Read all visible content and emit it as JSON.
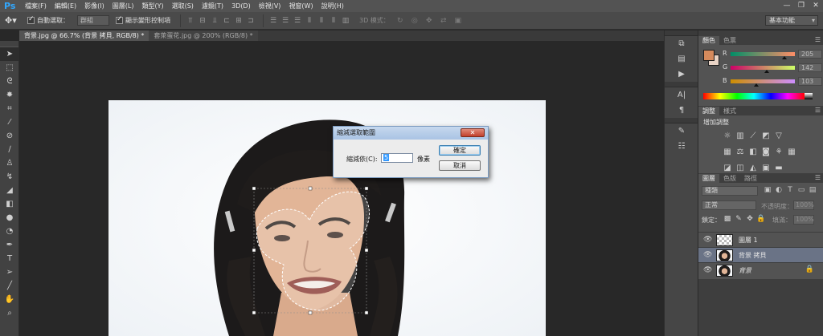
{
  "app": {
    "logo": "Ps"
  },
  "menu": [
    "檔案(F)",
    "編輯(E)",
    "影像(I)",
    "圖層(L)",
    "類型(Y)",
    "選取(S)",
    "濾鏡(T)",
    "3D(D)",
    "檢視(V)",
    "視窗(W)",
    "說明(H)"
  ],
  "window_controls": {
    "minimize": "—",
    "restore": "❐",
    "close": "✕"
  },
  "options": {
    "auto_select_label": "自動選取：",
    "auto_select_checked": true,
    "auto_select_target": "群組",
    "show_transform_label": "顯示變形控制項",
    "show_transform_checked": true,
    "mode_3d_label": "3D 模式：",
    "workspace": "基本功能"
  },
  "tabs": [
    {
      "label": "背景.jpg @ 66.7% (背景 拷貝, RGB/8) *",
      "active": true
    },
    {
      "label": "套萊蛋花.jpg @ 200% (RGB/8) *",
      "active": false
    }
  ],
  "tools": [
    "move-tool",
    "marquee-tool",
    "lasso-tool",
    "quick-select-tool",
    "crop-tool",
    "eyedropper-tool",
    "healing-brush-tool",
    "brush-tool",
    "clone-stamp-tool",
    "history-brush-tool",
    "eraser-tool",
    "gradient-tool",
    "blur-tool",
    "dodge-tool",
    "pen-tool",
    "type-tool",
    "path-select-tool",
    "shape-tool",
    "hand-tool",
    "zoom-tool"
  ],
  "dialog": {
    "title": "縮減選取範圍",
    "close": "✕",
    "field_label": "縮減依(C):",
    "field_value": "5",
    "unit": "像素",
    "ok": "確定",
    "cancel": "取消"
  },
  "color_panel": {
    "tabs": [
      "顏色",
      "色票"
    ],
    "foreground": "#d58a5c",
    "background": "#e8d3c5",
    "channels": [
      {
        "name": "R",
        "value": "205"
      },
      {
        "name": "G",
        "value": "142"
      },
      {
        "name": "B",
        "value": "103"
      }
    ]
  },
  "adjust_panel": {
    "tabs": [
      "調整",
      "樣式"
    ],
    "title": "增加調整"
  },
  "layers_panel": {
    "tabs": [
      "圖層",
      "色版",
      "路徑"
    ],
    "kind": "種類",
    "blend_mode": "正常",
    "opacity_label": "不透明度：",
    "opacity": "100%",
    "lock_label": "鎖定：",
    "fill_label": "填滿：",
    "fill": "100%",
    "layers": [
      {
        "name": "圖層 1",
        "selected": false,
        "locked": false,
        "italic": false
      },
      {
        "name": "背景 拷貝",
        "selected": true,
        "locked": false,
        "italic": false
      },
      {
        "name": "背景",
        "selected": false,
        "locked": true,
        "italic": true
      }
    ]
  }
}
